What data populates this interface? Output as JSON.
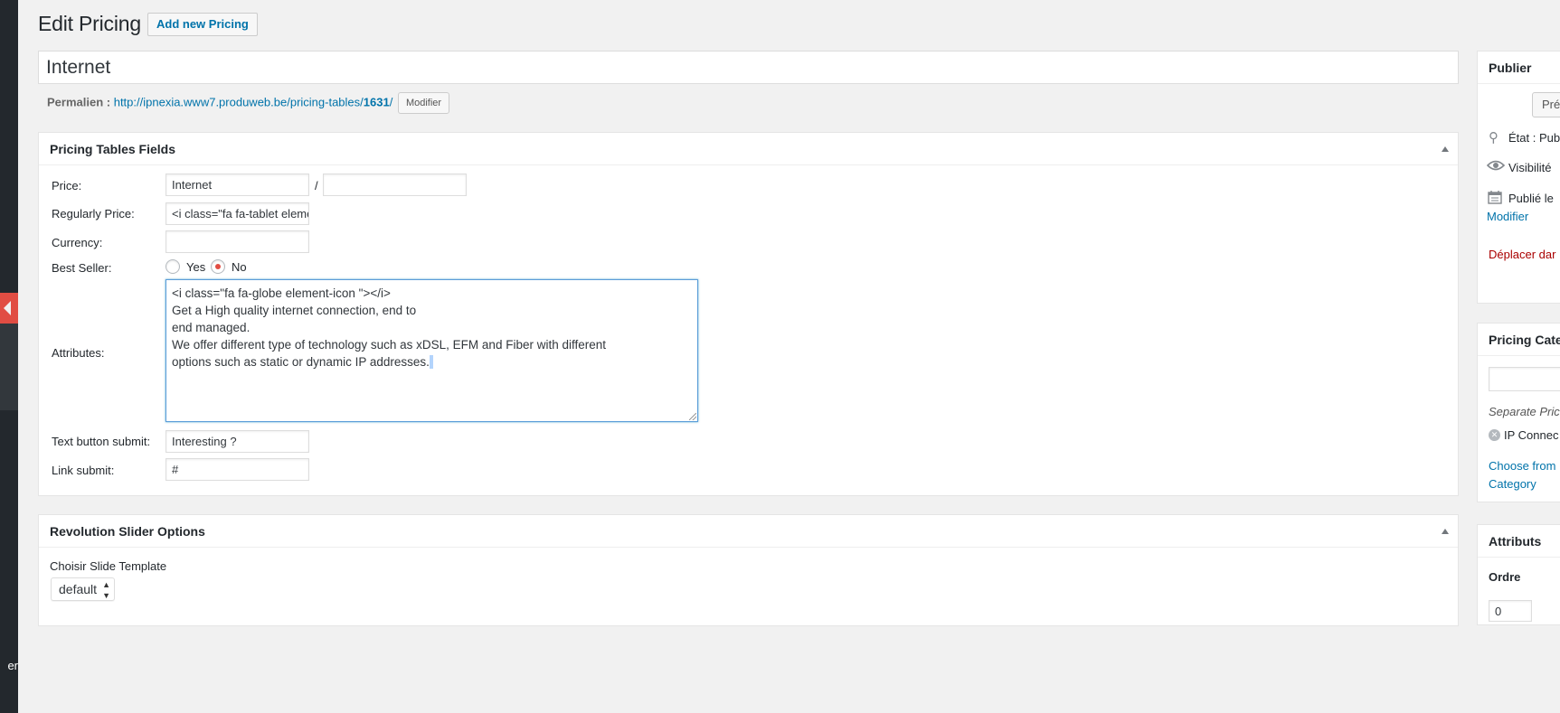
{
  "page": {
    "title": "Edit Pricing",
    "add_new_label": "Add new Pricing"
  },
  "adminbar": {
    "fragment": "er"
  },
  "post": {
    "title": "Internet",
    "permalink_label": "Permalien :",
    "permalink_base": "http://ipnexia.www7.produweb.be/pricing-tables/",
    "permalink_slug": "1631",
    "permalink_trailing": "/",
    "modify_label": "Modifier"
  },
  "pricing_fields": {
    "box_title": "Pricing Tables Fields",
    "price_label": "Price:",
    "price_value": "Internet",
    "price_period_value": "",
    "slash": "/",
    "regular_price_label": "Regularly Price:",
    "regular_price_value": "<i class=\"fa fa-tablet element-icon\"></i>",
    "currency_label": "Currency:",
    "currency_value": "",
    "best_seller_label": "Best Seller:",
    "best_seller_yes": "Yes",
    "best_seller_no": "No",
    "best_seller_selected": "No",
    "attributes_label": "Attributes:",
    "attributes_lines": [
      "<i class=\"fa fa-globe element-icon \"></i>",
      "Get a High quality internet connection, end to",
      "end managed.",
      "We offer different type of technology such as xDSL, EFM and Fiber with different",
      "options such as static or dynamic IP addresses."
    ],
    "text_button_label": "Text button submit:",
    "text_button_value": "Interesting ?",
    "link_submit_label": "Link submit:",
    "link_submit_value": "#"
  },
  "revolution_slider": {
    "box_title": "Revolution Slider Options",
    "template_label": "Choisir Slide Template",
    "template_value": "default"
  },
  "publish_box": {
    "title": "Publier",
    "preview_label": "Pré",
    "status_label": "État : Pub",
    "visibility_label": "Visibilité",
    "published_label": "Publié le",
    "modify_label": "Modifier",
    "trash_label": "Déplacer dar"
  },
  "pricing_category_box": {
    "title": "Pricing Cate",
    "input_value": "",
    "separate_label": "Separate Pric",
    "tag_label": "IP Connec",
    "choose_line1": "Choose from",
    "choose_line2": "Category"
  },
  "attributs_box": {
    "title": "Attributs",
    "order_label": "Ordre",
    "order_value": "0"
  },
  "colors": {
    "accent": "#0073aa",
    "adminbar": "#23282d",
    "active_menu": "#e14d43",
    "focus_border": "#5b9dd9",
    "trash": "#a00"
  }
}
